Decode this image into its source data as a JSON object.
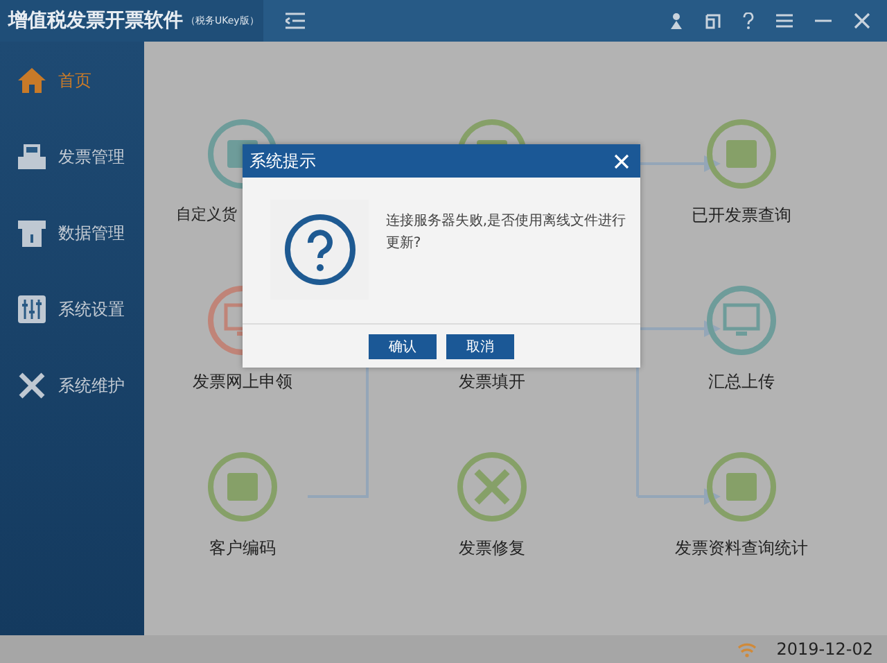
{
  "window": {
    "title": "增值税发票开票软件",
    "edition": "（税务UKey版）"
  },
  "sidebar": {
    "items": [
      {
        "label": "首页",
        "selected": true
      },
      {
        "label": "发票管理",
        "selected": false
      },
      {
        "label": "数据管理",
        "selected": false
      },
      {
        "label": "系统设置",
        "selected": false
      },
      {
        "label": "系统维护",
        "selected": false
      }
    ]
  },
  "tiles": [
    {
      "label": "自定义货",
      "color": "#6e9c9a"
    },
    {
      "color": "#86a068"
    },
    {
      "label": "已开发票查询",
      "color": "#86a068"
    },
    {
      "label": "发票网上申领",
      "color": "#c08478"
    },
    {
      "label": "发票填开"
    },
    {
      "label": "汇总上传",
      "color": "#6e9c9a"
    },
    {
      "label": "客户编码",
      "color": "#86a068"
    },
    {
      "label": "发票修复",
      "color": "#86a068"
    },
    {
      "label": "发票资料查询统计",
      "color": "#86a068"
    }
  ],
  "dialog": {
    "title": "系统提示",
    "message": "连接服务器失败,是否使用离线文件进行更新?",
    "buttons": [
      "确认",
      "取消"
    ]
  },
  "status_bar": {
    "date": "2019-12-02"
  }
}
